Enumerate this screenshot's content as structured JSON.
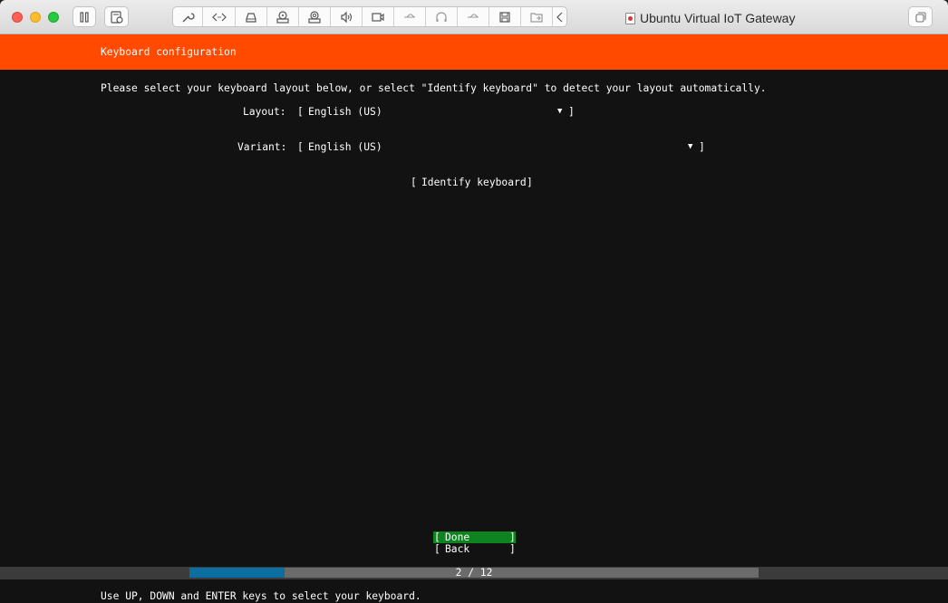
{
  "window": {
    "title": "Ubuntu Virtual IoT Gateway",
    "toolbar_icons": [
      "pause-icon",
      "snapshot-icon",
      "wrench-icon",
      "code-icon",
      "hard-disk-icon",
      "optical-drive-icon",
      "camera-drive-icon",
      "sound-icon",
      "video-camera-icon",
      "usb-icon",
      "headphones-icon",
      "usb-icon",
      "floppy-disk-icon",
      "shared-folder-icon",
      "collapse-chevron-icon",
      "fullscreen-icon"
    ]
  },
  "installer": {
    "header": "Keyboard configuration",
    "intro": "Please select your keyboard layout below, or select \"Identify keyboard\" to detect your layout automatically.",
    "layout": {
      "label": "Layout:",
      "value": "English (US)",
      "arrow": "▼"
    },
    "variant": {
      "label": "Variant:",
      "value": "English (US)",
      "arrow": "▼"
    },
    "identify_button": "Identify keyboard",
    "buttons": {
      "done": "Done",
      "back": "Back"
    },
    "progress": {
      "text": "2 / 12",
      "current": 2,
      "total": 12
    },
    "footer_hint": "Use UP, DOWN and ENTER keys to select your keyboard."
  },
  "colors": {
    "accent": "#ff4a00",
    "done_bg": "#0e8420",
    "progress_fill": "#0a6fa0",
    "screen_bg": "#121212"
  }
}
